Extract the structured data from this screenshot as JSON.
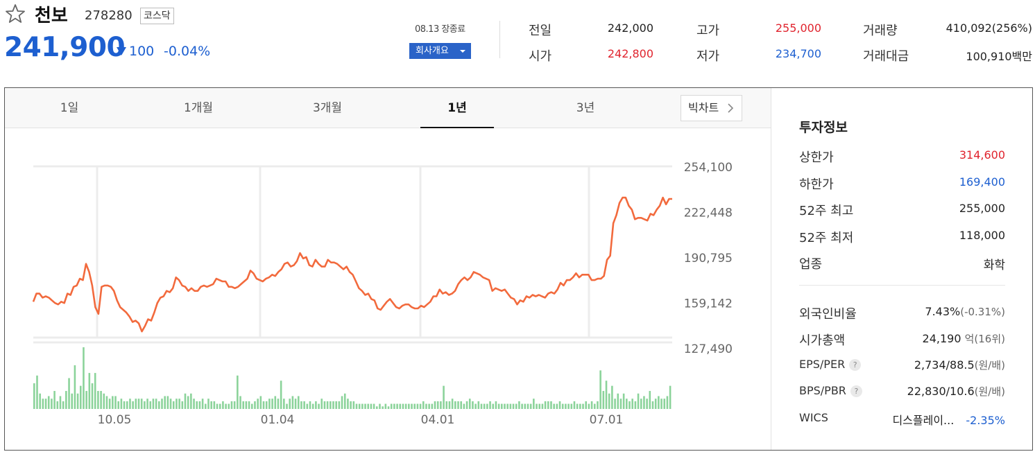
{
  "stock": {
    "name": "천보",
    "code": "278280",
    "market": "코스닥",
    "price": "241,900",
    "change": "100",
    "change_pct": "-0.04%",
    "direction": "down"
  },
  "status": {
    "text": "08.13 장종료",
    "overview_label": "회사개요"
  },
  "quote": {
    "prev_close_label": "전일",
    "prev_close": "242,000",
    "high_label": "고가",
    "high": "255,000",
    "volume_label": "거래량",
    "volume": "410,092(256%)",
    "open_label": "시가",
    "open": "242,800",
    "low_label": "저가",
    "low": "234,700",
    "trade_value_label": "거래대금",
    "trade_value": "100,910백만"
  },
  "tabs": [
    {
      "label": "1일",
      "active": false
    },
    {
      "label": "1개월",
      "active": false
    },
    {
      "label": "3개월",
      "active": false
    },
    {
      "label": "1년",
      "active": true
    },
    {
      "label": "3년",
      "active": false
    }
  ],
  "bigchart_label": "빅차트",
  "info": {
    "title": "투자정보",
    "upper_limit_label": "상한가",
    "upper_limit": "314,600",
    "lower_limit_label": "하한가",
    "lower_limit": "169,400",
    "high52_label": "52주 최고",
    "high52": "255,000",
    "low52_label": "52주 최저",
    "low52": "118,000",
    "sector_label": "업종",
    "sector": "화학",
    "foreign_label": "외국인비율",
    "foreign": "7.43%",
    "foreign_chg": "(-0.31%)",
    "mktcap_label": "시가총액",
    "mktcap": "24,190",
    "mktcap_unit": "억",
    "mktcap_rank": "(16위)",
    "eps_per_label": "EPS/PER",
    "eps_per": "2,734/88.5",
    "eps_per_unit": "(원/배)",
    "bps_pbr_label": "BPS/PBR",
    "bps_pbr": "22,830/10.6",
    "bps_pbr_unit": "(원/배)",
    "wics_label": "WICS",
    "wics": "디스플레이...",
    "wics_chg": "-2.35%"
  },
  "colors": {
    "up": "#e0232d",
    "down": "#1d5fd0",
    "line": "#f26a3d",
    "volume": "#8bd39a",
    "button": "#2a63c8"
  },
  "chart_data": {
    "type": "line",
    "y_ticks": [
      "254,100",
      "222,448",
      "190,795",
      "159,142",
      "127,490"
    ],
    "ylim": [
      127490,
      254100
    ],
    "x_ticks": [
      "10.05",
      "01.04",
      "04.01",
      "07.01"
    ],
    "series": [
      {
        "values": [
          154000,
          160000,
          160000,
          157000,
          158000,
          157000,
          155000,
          153000,
          152000,
          154000,
          153000,
          160000,
          159000,
          165000,
          166000,
          171000,
          170000,
          182000,
          176000,
          166000,
          150000,
          145000,
          165000,
          166000,
          166000,
          165000,
          162000,
          155000,
          150000,
          148000,
          146000,
          143000,
          139000,
          140000,
          138000,
          132000,
          136000,
          141000,
          140000,
          146000,
          153000,
          157000,
          158000,
          162000,
          161000,
          164000,
          172000,
          170000,
          166000,
          165000,
          162000,
          164000,
          162000,
          162000,
          165000,
          166000,
          165000,
          166000,
          167000,
          171000,
          170000,
          169000,
          169000,
          165000,
          165000,
          164000,
          165000,
          167000,
          169000,
          171000,
          177000,
          175000,
          171000,
          170000,
          169000,
          171000,
          172000,
          174000,
          173000,
          176000,
          178000,
          182000,
          183000,
          180000,
          181000,
          184000,
          190000,
          186000,
          187000,
          181000,
          180000,
          185000,
          182000,
          180000,
          180000,
          185000,
          183000,
          183000,
          182000,
          180000,
          178000,
          180000,
          176000,
          174000,
          169000,
          164000,
          162000,
          159000,
          160000,
          156000,
          155000,
          149000,
          148000,
          151000,
          154000,
          156000,
          153000,
          150000,
          149000,
          151000,
          152000,
          152000,
          150000,
          149000,
          149000,
          151000,
          150000,
          152000,
          154000,
          158000,
          158000,
          163000,
          160000,
          161000,
          159000,
          160000,
          162000,
          167000,
          170000,
          172000,
          170000,
          172000,
          176000,
          175000,
          174000,
          172000,
          171000,
          170000,
          162000,
          164000,
          163000,
          162000,
          163000,
          160000,
          157000,
          156000,
          152000,
          155000,
          154000,
          158000,
          157000,
          159000,
          158000,
          159000,
          158000,
          157000,
          160000,
          161000,
          160000,
          163000,
          168000,
          166000,
          170000,
          170000,
          172000,
          175000,
          172000,
          174000,
          174000,
          174000,
          170000,
          170000,
          171000,
          171000,
          173000,
          185000,
          188000,
          212000,
          218000,
          227000,
          231000,
          231000,
          225000,
          222000,
          215000,
          216000,
          216000,
          215000,
          214000,
          219000,
          218000,
          222000,
          225000,
          231000,
          226000,
          230000,
          230000
        ]
      }
    ],
    "volume": [
      10,
      13,
      6,
      4,
      4,
      5,
      4,
      7,
      3,
      5,
      3,
      7,
      12,
      6,
      17,
      6,
      9,
      24,
      7,
      14,
      10,
      14,
      7,
      7,
      6,
      5,
      4,
      5,
      5,
      3,
      4,
      3,
      3,
      4,
      3,
      4,
      4,
      4,
      3,
      4,
      3,
      4,
      4,
      3,
      4,
      5,
      5,
      4,
      3,
      4,
      4,
      3,
      6,
      5,
      6,
      4,
      3,
      3,
      4,
      2,
      4,
      3,
      3,
      2,
      2,
      3,
      2,
      2,
      3,
      3,
      13,
      5,
      3,
      3,
      3,
      2,
      3,
      4,
      5,
      3,
      3,
      4,
      4,
      5,
      4,
      11,
      4,
      2,
      4,
      5,
      4,
      5,
      3,
      3,
      2,
      3,
      2,
      3,
      2,
      4,
      3,
      3,
      3,
      3,
      3,
      3,
      5,
      6,
      4,
      3,
      3,
      2,
      2,
      2,
      2,
      2,
      2,
      2,
      1,
      2,
      1,
      2,
      1,
      2,
      2,
      2,
      2,
      2,
      2,
      2,
      2,
      2,
      2,
      2,
      3,
      2,
      2,
      2,
      3,
      3,
      3,
      9,
      3,
      3,
      4,
      3,
      3,
      3,
      2,
      3,
      4,
      3,
      2,
      3,
      2,
      2,
      2,
      3,
      2,
      3,
      2,
      2,
      2,
      2,
      2,
      2,
      2,
      3,
      2,
      2,
      2,
      2,
      4,
      2,
      2,
      2,
      3,
      3,
      3,
      2,
      2,
      3,
      2,
      2,
      2,
      2,
      3,
      2,
      2,
      2,
      3,
      2,
      3,
      2,
      3,
      15,
      7,
      11,
      6,
      9,
      4,
      6,
      4,
      6,
      4,
      3,
      4,
      3,
      6,
      4,
      5,
      4,
      7,
      3,
      4,
      5,
      4,
      4,
      5,
      9
    ]
  }
}
